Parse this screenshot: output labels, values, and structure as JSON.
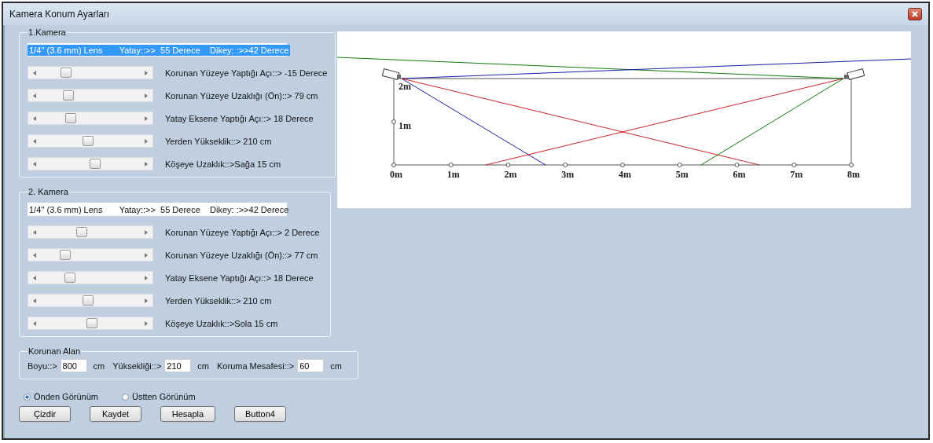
{
  "window": {
    "title": "Kamera Konum Ayarları"
  },
  "cameras": [
    {
      "title": "1.Kamera",
      "lens": {
        "value": "1/4'' (3.6 mm) Lens       Yatay::>>  55 Derece    Dikey: :>>42 Derece",
        "selected": true
      },
      "sliders": [
        {
          "label": "Korunan Yüzeye Yaptığı Açı::> -15 Derece"
        },
        {
          "label": "Korunan Yüzeye Uzaklığı (Ön)::> 79 cm"
        },
        {
          "label": "Yatay Eksene Yaptığı Açı::> 18 Derece"
        },
        {
          "label": "Yerden Yükseklik::> 210 cm"
        },
        {
          "label": "Köşeye Uzaklık::>Sağa 15 cm"
        }
      ]
    },
    {
      "title": "2. Kamera",
      "lens": {
        "value": "1/4'' (3.6 mm) Lens       Yatay::>>  55 Derece    Dikey: :>>42 Derece",
        "selected": false
      },
      "sliders": [
        {
          "label": "Korunan Yüzeye Yaptığı Açı::> 2 Derece"
        },
        {
          "label": "Korunan Yüzeye Uzaklığı (Ön)::> 77 cm"
        },
        {
          "label": "Yatay Eksene Yaptığı Açı::> 18 Derece"
        },
        {
          "label": "Yerden Yükseklik::> 210 cm"
        },
        {
          "label": "Köşeye Uzaklık::>Sola 15 cm"
        }
      ]
    }
  ],
  "area": {
    "title": "Korunan Alan",
    "fields": [
      {
        "label": "Boyu::>",
        "value": "800",
        "unit": "cm"
      },
      {
        "label": "Yüksekliği::>",
        "value": "210",
        "unit": "cm"
      },
      {
        "label": "Koruma Mesafesi::>",
        "value": "60",
        "unit": "cm"
      }
    ]
  },
  "views": [
    {
      "label": "Önden Görünüm",
      "selected": true
    },
    {
      "label": "Üstten Görünüm",
      "selected": false
    }
  ],
  "buttons": [
    "Çizdir",
    "Kaydet",
    "Hesapla",
    "Button4"
  ],
  "diagram": {
    "x_labels": [
      "0m",
      "1m",
      "2m",
      "3m",
      "4m",
      "5m",
      "6m",
      "7m",
      "8m"
    ],
    "y_labels": [
      "2m",
      "1m"
    ]
  }
}
